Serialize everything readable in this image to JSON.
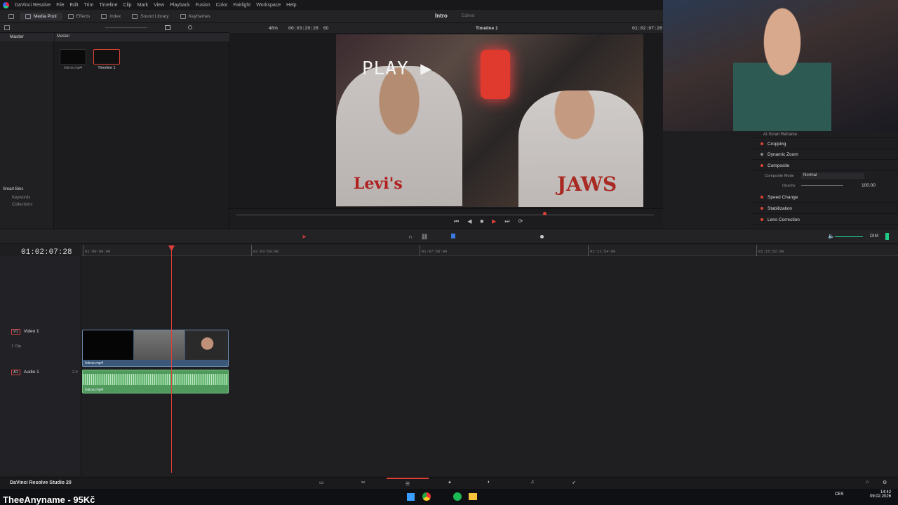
{
  "app": {
    "name": "DaVinci Resolve",
    "bottom_label": "DaVinci Resolve Studio 20"
  },
  "menu": [
    "DaVinci Resolve",
    "File",
    "Edit",
    "Trim",
    "Timeline",
    "Clip",
    "Mark",
    "View",
    "Playback",
    "Fusion",
    "Color",
    "Fairlight",
    "Workspace",
    "Help"
  ],
  "toolbar": {
    "media_pool": "Media Pool",
    "effects": "Effects",
    "index": "Index",
    "sound_library": "Sound Library",
    "keyframes": "Keyframes"
  },
  "project": {
    "title": "Intro",
    "status": "Edited"
  },
  "media_pool": {
    "bin": "Master",
    "bin_header": "Master",
    "items": [
      {
        "label": "Intros.mp4"
      },
      {
        "label": "Timeline 1"
      }
    ],
    "smart_bins": "Smart Bins",
    "smart_items": [
      "Keywords",
      "Collections"
    ]
  },
  "viewer": {
    "zoom": "46%",
    "duration": "00:03:29:28",
    "fps": "60",
    "timeline_name": "Timeline 1",
    "timecode": "01:02:07:28",
    "overlay_play": "PLAY",
    "shirt1": "Levi's",
    "shirt2": "JAWS"
  },
  "inspector": {
    "items": [
      "AI Smart Reframe",
      "Cropping",
      "Dynamic Zoom",
      "Composite",
      "Speed Change",
      "Stabilization",
      "Lens Correction"
    ],
    "composite_mode_label": "Composite Mode",
    "composite_mode_value": "Normal",
    "opacity_label": "Opacity",
    "opacity_value": "100.00"
  },
  "timeline": {
    "timecode": "01:02:07:28",
    "ruler": [
      "01:00:00:00",
      "01:03:58:00",
      "01:07:56:00",
      "01:11:54:00",
      "01:15:52:00"
    ],
    "tracks": [
      {
        "id": "V1",
        "name": "Video 1",
        "sub": "1 Clip",
        "clip": "Intros.mp4"
      },
      {
        "id": "A1",
        "name": "Audio 1",
        "level": "2.0",
        "clip": "Intros.mp4"
      }
    ],
    "dim": "DIM"
  },
  "taskbar": {
    "lang": "CES",
    "time": "14:42",
    "date": "09.02.2026"
  },
  "stream_overlay": "TheeAnyname - 95Kč"
}
